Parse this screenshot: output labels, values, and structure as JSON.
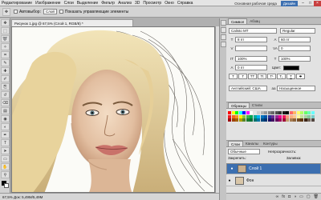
{
  "menubar": {
    "items": [
      "Редактирование",
      "Изображение",
      "Слои",
      "Выделение",
      "Фильтр",
      "Анализ",
      "3D",
      "Просмотр",
      "Окно",
      "Справка"
    ],
    "workspaces": [
      "Основная рабочая среда",
      "Дизайн"
    ],
    "window_buttons": [
      "–",
      "□",
      "×"
    ]
  },
  "optbar": {
    "auto_select_label": "Автовыбор:",
    "auto_select_value": "Слой",
    "show_controls_label": "Показать управляющие элементы"
  },
  "document": {
    "tab_title": "Рисунок 1.jpg @ 67,5% (Слой 1, RGB/8) *",
    "status": "67,5%   Док: 5,49M/5,49M"
  },
  "toolbox": {
    "tools": [
      "move-icon",
      "marquee-icon",
      "lasso-icon",
      "magic-wand-icon",
      "crop-icon",
      "eyedropper-icon",
      "healing-icon",
      "brush-icon",
      "stamp-icon",
      "history-brush-icon",
      "eraser-icon",
      "gradient-icon",
      "blur-icon",
      "dodge-icon",
      "pen-icon",
      "type-icon",
      "path-select-icon",
      "shape-icon",
      "hand-icon",
      "zoom-icon"
    ],
    "tool_glyphs": [
      "✥",
      "⬚",
      "➰",
      "✧",
      "⌗",
      "✎",
      "✚",
      "✐",
      "⎘",
      "↺",
      "⌫",
      "▤",
      "◉",
      "◐",
      "✒",
      "T",
      "➤",
      "▭",
      "✋",
      "⚲"
    ]
  },
  "character_panel": {
    "tabs": [
      "Символ",
      "Абзац"
    ],
    "font_family": "Calisto MT",
    "font_style": "Regular",
    "size": "8 пт",
    "leading": "60 пт",
    "kerning": "",
    "tracking": "0",
    "vscale": "100%",
    "hscale": "100%",
    "baseline": "0 пт",
    "color_label": "Цвет:",
    "language": "Английский: США",
    "antialias": "Насыщенное",
    "aa_prefix": "aa"
  },
  "swatches_panel": {
    "tabs": [
      "Образцы",
      "Стили"
    ],
    "colors": [
      "#ff0000",
      "#ffff00",
      "#00ff00",
      "#00ffff",
      "#0000ff",
      "#ff00ff",
      "#ffffff",
      "#e6e6e6",
      "#cccccc",
      "#b3b3b3",
      "#999999",
      "#808080",
      "#666666",
      "#4d4d4d",
      "#333333",
      "#1a1a1a",
      "#000000",
      "#ff6666",
      "#ffb366",
      "#ffff66",
      "#b3ff66",
      "#66ff66",
      "#66ffb3",
      "#66ffff",
      "#ed1c24",
      "#f26522",
      "#f7941d",
      "#fff200",
      "#8dc63f",
      "#39b54a",
      "#00a651",
      "#00a99d",
      "#00aeef",
      "#0072bc",
      "#0054a6",
      "#2e3192",
      "#662d91",
      "#92278f",
      "#ec008c",
      "#ed145b",
      "#f69679",
      "#f9ad81",
      "#fdc68a",
      "#fff799",
      "#c4df9b",
      "#a3d39c",
      "#82ca9d",
      "#7accc8",
      "#9e0b0f",
      "#a0410d",
      "#a36209",
      "#aba000",
      "#598527",
      "#1a7b30",
      "#007236",
      "#00746b",
      "#0076a3",
      "#004b80",
      "#003471",
      "#1b1464",
      "#440e62",
      "#630460",
      "#9e005d",
      "#9e0039",
      "#c69c6d",
      "#a67c52",
      "#8c6239",
      "#754c24",
      "#603913",
      "#3c2415",
      "#736357",
      "#534741"
    ]
  },
  "layers_panel": {
    "tabs": [
      "Слои",
      "Каналы",
      "Контуры"
    ],
    "blend_mode": "Обычные",
    "opacity_label": "Непрозрачность:",
    "lock_label": "Закрепить:",
    "fill_label": "Заливка:",
    "layers": [
      {
        "name": "Слой 1",
        "selected": true,
        "visible": true,
        "thumb": "#c8b090"
      },
      {
        "name": "Фон",
        "selected": false,
        "visible": true,
        "thumb": "#d9c6a8"
      }
    ],
    "footer_icons": [
      "link-icon",
      "fx-icon",
      "mask-icon",
      "adjustment-icon",
      "folder-icon",
      "new-layer-icon",
      "trash-icon"
    ],
    "footer_glyphs": [
      "∞",
      "fx",
      "◘",
      "◑",
      "▭",
      "▢",
      "🗑"
    ]
  },
  "colors": {
    "accent": "#3c6fb0",
    "close": "#c84040"
  }
}
